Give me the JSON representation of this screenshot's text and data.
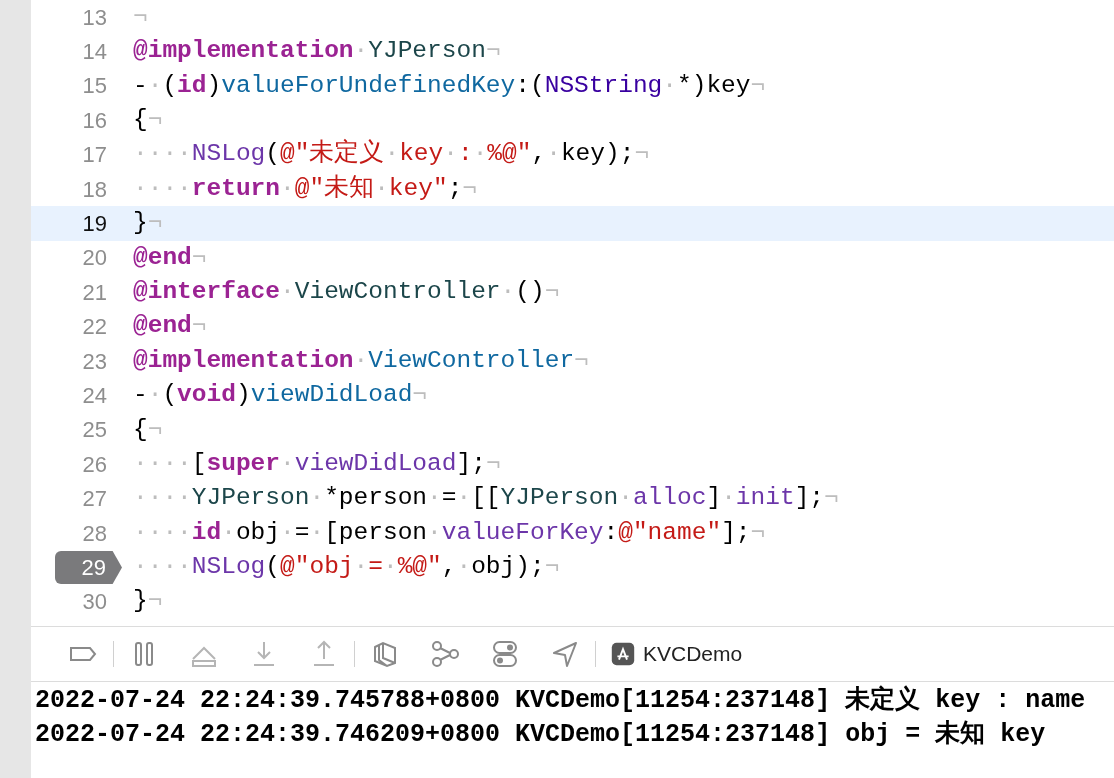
{
  "editor": {
    "lines": [
      {
        "number": "13",
        "current": false,
        "breakpoint": false,
        "tokens": [
          {
            "kind": "ws",
            "text": "¬"
          }
        ]
      },
      {
        "number": "14",
        "current": false,
        "breakpoint": false,
        "tokens": [
          {
            "kind": "kw",
            "text": "@implementation"
          },
          {
            "kind": "ws",
            "text": "·"
          },
          {
            "kind": "cls",
            "text": "YJPerson"
          },
          {
            "kind": "ws",
            "text": "¬"
          }
        ]
      },
      {
        "number": "15",
        "current": false,
        "breakpoint": false,
        "tokens": [
          {
            "kind": "p",
            "text": "-"
          },
          {
            "kind": "ws",
            "text": "·"
          },
          {
            "kind": "p",
            "text": "("
          },
          {
            "kind": "kw",
            "text": "id"
          },
          {
            "kind": "p",
            "text": ")"
          },
          {
            "kind": "m",
            "text": "valueForUndefinedKey"
          },
          {
            "kind": "p",
            "text": ":("
          },
          {
            "kind": "sys",
            "text": "NSString"
          },
          {
            "kind": "ws",
            "text": "·"
          },
          {
            "kind": "p",
            "text": "*)key"
          },
          {
            "kind": "ws",
            "text": "¬"
          }
        ]
      },
      {
        "number": "16",
        "current": false,
        "breakpoint": false,
        "tokens": [
          {
            "kind": "p",
            "text": "{"
          },
          {
            "kind": "ws",
            "text": "¬"
          }
        ]
      },
      {
        "number": "17",
        "current": false,
        "breakpoint": false,
        "tokens": [
          {
            "kind": "ws",
            "text": "····"
          },
          {
            "kind": "fn",
            "text": "NSLog"
          },
          {
            "kind": "p",
            "text": "("
          },
          {
            "kind": "s",
            "text": "@\"未定义"
          },
          {
            "kind": "ws",
            "text": "·"
          },
          {
            "kind": "s",
            "text": "key"
          },
          {
            "kind": "ws",
            "text": "·"
          },
          {
            "kind": "s",
            "text": ":"
          },
          {
            "kind": "ws",
            "text": "·"
          },
          {
            "kind": "s",
            "text": "%@\""
          },
          {
            "kind": "p",
            "text": ","
          },
          {
            "kind": "ws",
            "text": "·"
          },
          {
            "kind": "p",
            "text": "key);"
          },
          {
            "kind": "ws",
            "text": "¬"
          }
        ]
      },
      {
        "number": "18",
        "current": false,
        "breakpoint": false,
        "tokens": [
          {
            "kind": "ws",
            "text": "····"
          },
          {
            "kind": "kw",
            "text": "return"
          },
          {
            "kind": "ws",
            "text": "·"
          },
          {
            "kind": "s",
            "text": "@\"未知"
          },
          {
            "kind": "ws",
            "text": "·"
          },
          {
            "kind": "s",
            "text": "key\""
          },
          {
            "kind": "p",
            "text": ";"
          },
          {
            "kind": "ws",
            "text": "¬"
          }
        ]
      },
      {
        "number": "19",
        "current": true,
        "breakpoint": false,
        "tokens": [
          {
            "kind": "p",
            "text": "}"
          },
          {
            "kind": "ws",
            "text": "¬"
          }
        ]
      },
      {
        "number": "20",
        "current": false,
        "breakpoint": false,
        "tokens": [
          {
            "kind": "kw",
            "text": "@end"
          },
          {
            "kind": "ws",
            "text": "¬"
          }
        ]
      },
      {
        "number": "21",
        "current": false,
        "breakpoint": false,
        "tokens": [
          {
            "kind": "kw",
            "text": "@interface"
          },
          {
            "kind": "ws",
            "text": "·"
          },
          {
            "kind": "cls",
            "text": "ViewController"
          },
          {
            "kind": "ws",
            "text": "·"
          },
          {
            "kind": "p",
            "text": "()"
          },
          {
            "kind": "ws",
            "text": "¬"
          }
        ]
      },
      {
        "number": "22",
        "current": false,
        "breakpoint": false,
        "tokens": [
          {
            "kind": "kw",
            "text": "@end"
          },
          {
            "kind": "ws",
            "text": "¬"
          }
        ]
      },
      {
        "number": "23",
        "current": false,
        "breakpoint": false,
        "tokens": [
          {
            "kind": "kw",
            "text": "@implementation"
          },
          {
            "kind": "ws",
            "text": "·"
          },
          {
            "kind": "m",
            "text": "ViewController"
          },
          {
            "kind": "ws",
            "text": "¬"
          }
        ]
      },
      {
        "number": "24",
        "current": false,
        "breakpoint": false,
        "tokens": [
          {
            "kind": "p",
            "text": "-"
          },
          {
            "kind": "ws",
            "text": "·"
          },
          {
            "kind": "p",
            "text": "("
          },
          {
            "kind": "kw",
            "text": "void"
          },
          {
            "kind": "p",
            "text": ")"
          },
          {
            "kind": "m",
            "text": "viewDidLoad"
          },
          {
            "kind": "ws",
            "text": "¬"
          }
        ]
      },
      {
        "number": "25",
        "current": false,
        "breakpoint": false,
        "tokens": [
          {
            "kind": "p",
            "text": "{"
          },
          {
            "kind": "ws",
            "text": "¬"
          }
        ]
      },
      {
        "number": "26",
        "current": false,
        "breakpoint": false,
        "tokens": [
          {
            "kind": "ws",
            "text": "····"
          },
          {
            "kind": "p",
            "text": "["
          },
          {
            "kind": "kw",
            "text": "super"
          },
          {
            "kind": "ws",
            "text": "·"
          },
          {
            "kind": "fn",
            "text": "viewDidLoad"
          },
          {
            "kind": "p",
            "text": "];"
          },
          {
            "kind": "ws",
            "text": "¬"
          }
        ]
      },
      {
        "number": "27",
        "current": false,
        "breakpoint": false,
        "tokens": [
          {
            "kind": "ws",
            "text": "····"
          },
          {
            "kind": "cls",
            "text": "YJPerson"
          },
          {
            "kind": "ws",
            "text": "·"
          },
          {
            "kind": "p",
            "text": "*person"
          },
          {
            "kind": "ws",
            "text": "·"
          },
          {
            "kind": "p",
            "text": "="
          },
          {
            "kind": "ws",
            "text": "·"
          },
          {
            "kind": "p",
            "text": "[["
          },
          {
            "kind": "cls",
            "text": "YJPerson"
          },
          {
            "kind": "ws",
            "text": "·"
          },
          {
            "kind": "fn",
            "text": "alloc"
          },
          {
            "kind": "p",
            "text": "]"
          },
          {
            "kind": "ws",
            "text": "·"
          },
          {
            "kind": "fn",
            "text": "init"
          },
          {
            "kind": "p",
            "text": "];"
          },
          {
            "kind": "ws",
            "text": "¬"
          }
        ]
      },
      {
        "number": "28",
        "current": false,
        "breakpoint": false,
        "tokens": [
          {
            "kind": "ws",
            "text": "····"
          },
          {
            "kind": "kw",
            "text": "id"
          },
          {
            "kind": "ws",
            "text": "·"
          },
          {
            "kind": "p",
            "text": "obj"
          },
          {
            "kind": "ws",
            "text": "·"
          },
          {
            "kind": "p",
            "text": "="
          },
          {
            "kind": "ws",
            "text": "·"
          },
          {
            "kind": "p",
            "text": "[person"
          },
          {
            "kind": "ws",
            "text": "·"
          },
          {
            "kind": "fn",
            "text": "valueForKey"
          },
          {
            "kind": "p",
            "text": ":"
          },
          {
            "kind": "s",
            "text": "@\"name\""
          },
          {
            "kind": "p",
            "text": "];"
          },
          {
            "kind": "ws",
            "text": "¬"
          }
        ]
      },
      {
        "number": "29",
        "current": false,
        "breakpoint": true,
        "tokens": [
          {
            "kind": "ws",
            "text": "····"
          },
          {
            "kind": "fn",
            "text": "NSLog"
          },
          {
            "kind": "p",
            "text": "("
          },
          {
            "kind": "s",
            "text": "@\"obj"
          },
          {
            "kind": "ws",
            "text": "·"
          },
          {
            "kind": "s",
            "text": "="
          },
          {
            "kind": "ws",
            "text": "·"
          },
          {
            "kind": "s",
            "text": "%@\""
          },
          {
            "kind": "p",
            "text": ","
          },
          {
            "kind": "ws",
            "text": "·"
          },
          {
            "kind": "p",
            "text": "obj);"
          },
          {
            "kind": "ws",
            "text": "¬"
          }
        ]
      },
      {
        "number": "30",
        "current": false,
        "breakpoint": false,
        "tokens": [
          {
            "kind": "p",
            "text": "}"
          },
          {
            "kind": "ws",
            "text": "¬"
          }
        ]
      }
    ]
  },
  "debug_bar": {
    "target": "KVCDemo"
  },
  "console": {
    "lines": [
      "2022-07-24 22:24:39.745788+0800 KVCDemo[11254:237148] 未定义 key : name",
      "2022-07-24 22:24:39.746209+0800 KVCDemo[11254:237148] obj = 未知 key"
    ]
  }
}
